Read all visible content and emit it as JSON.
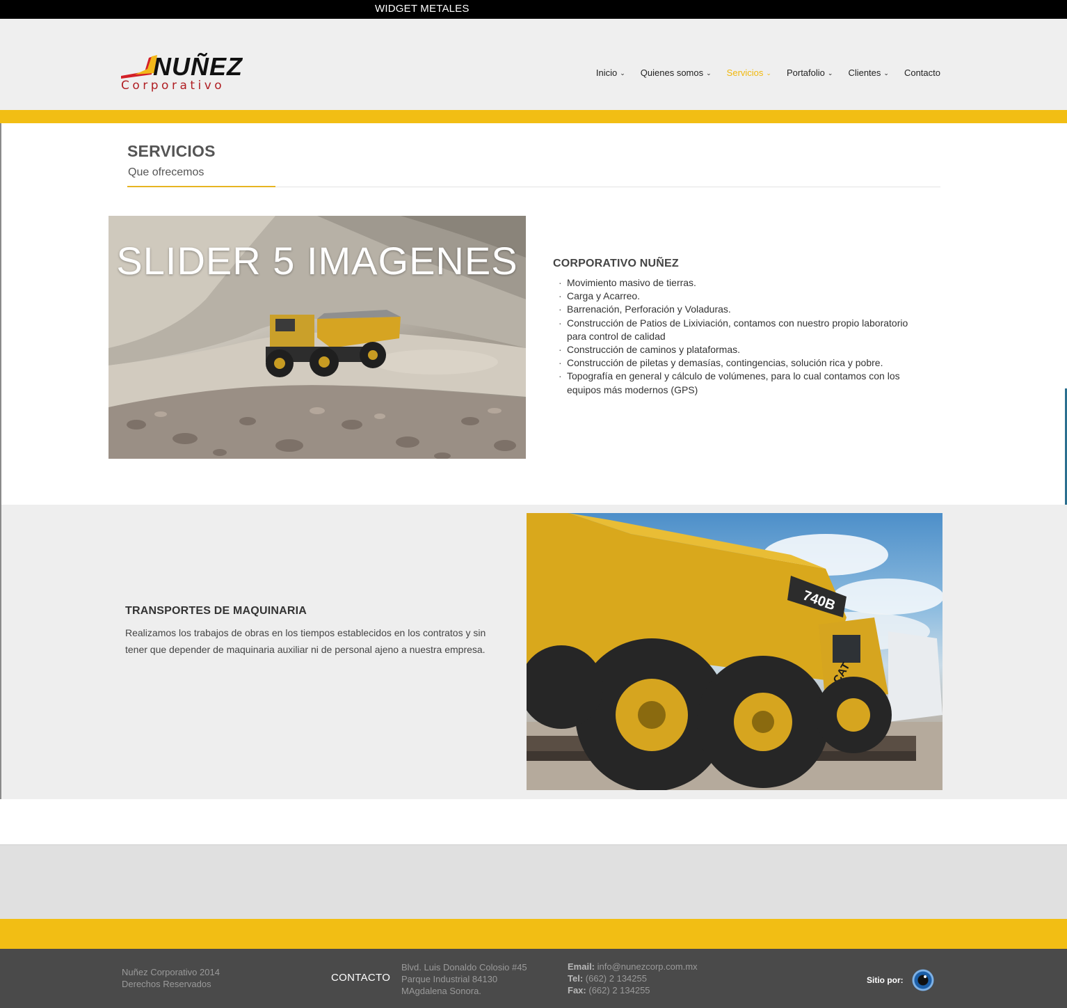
{
  "topbar": {
    "label": "WIDGET METALES"
  },
  "header": {
    "logo": {
      "name": "NUÑEZ",
      "sub": "Corporativo"
    },
    "nav": [
      {
        "label": "Inicio",
        "has_dropdown": true
      },
      {
        "label": "Quienes somos",
        "has_dropdown": true
      },
      {
        "label": "Servicios",
        "has_dropdown": true,
        "active": true
      },
      {
        "label": "Portafolio",
        "has_dropdown": true
      },
      {
        "label": "Clientes",
        "has_dropdown": true
      },
      {
        "label": "Contacto",
        "has_dropdown": false
      }
    ]
  },
  "section": {
    "title": "SERVICIOS",
    "subtitle": "Que ofrecemos"
  },
  "slider": {
    "caption": "SLIDER 5 IMAGENES"
  },
  "corporativo": {
    "title": "CORPORATIVO NUÑEZ",
    "items": [
      "Movimiento masivo de tierras.",
      "Carga y Acarreo.",
      "Barrenación, Perforación y Voladuras.",
      "Construcción de Patios de Lixiviación, contamos con nuestro propio laboratorio para control de calidad",
      "Construcción de caminos y plataformas.",
      "Construcción de piletas y demasías, contingencias, solución rica y pobre.",
      "Topografía en general y cálculo de volúmenes, para lo cual contamos con los equipos más modernos (GPS)"
    ]
  },
  "transportes": {
    "title": "TRANSPORTES DE MAQUINARIA",
    "text": "Realizamos los  trabajos de obras en los tiempos establecidos  en los contratos y sin tener que depender de maquinaria auxiliar ni de personal ajeno a nuestra empresa.",
    "truck_model": "740B",
    "truck_brand": "CAT"
  },
  "footer": {
    "copyright_line1": "Nuñez Corporativo 2014",
    "copyright_line2": "Derechos Reservados",
    "contact_label": "CONTACTO",
    "address_line1": "Blvd. Luis Donaldo Colosio #45",
    "address_line2": "Parque Industrial 84130",
    "address_line3": "MAgdalena Sonora.",
    "email_label": "Email:",
    "email": "info@nunezcorp.com.mx",
    "tel_label": "Tel:",
    "tel": "(662) 2 134255",
    "fax_label": "Fax:",
    "fax": "(662) 2 134255",
    "sitio_label": "Sitio por:"
  },
  "colors": {
    "accent_yellow": "#f2be14",
    "nav_active": "#f1b80c",
    "logo_red": "#b01e23",
    "footer_dark": "#4a4a4a"
  }
}
